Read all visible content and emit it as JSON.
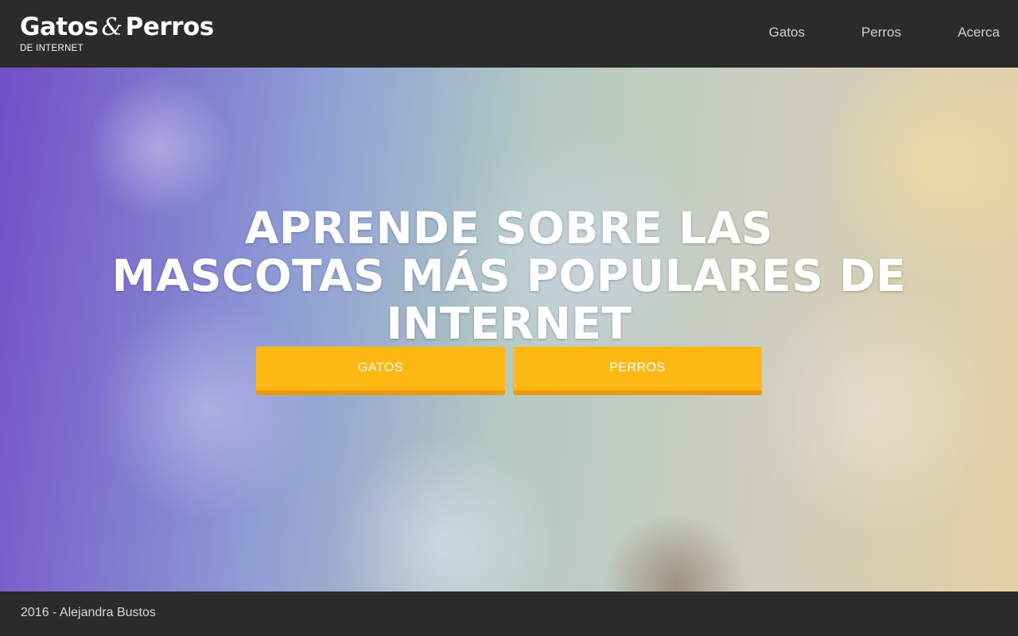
{
  "header": {
    "brand": {
      "word1": "Gatos",
      "amp": "&",
      "word2": "Perros",
      "subtitle": "DE INTERNET"
    },
    "nav": [
      {
        "label": "Gatos"
      },
      {
        "label": "Perros"
      },
      {
        "label": "Acerca"
      }
    ]
  },
  "hero": {
    "title": "APRENDE SOBRE LAS MASCOTAS MÁS POPULARES DE INTERNET",
    "buttons": [
      {
        "label": "GATOS"
      },
      {
        "label": "PERROS"
      }
    ],
    "colors": {
      "button": "#fdb813",
      "button_shadow": "#e89a0a"
    }
  },
  "footer": {
    "text": "2016 - Alejandra Bustos"
  },
  "colors": {
    "bar_background": "#2b2b2b"
  }
}
